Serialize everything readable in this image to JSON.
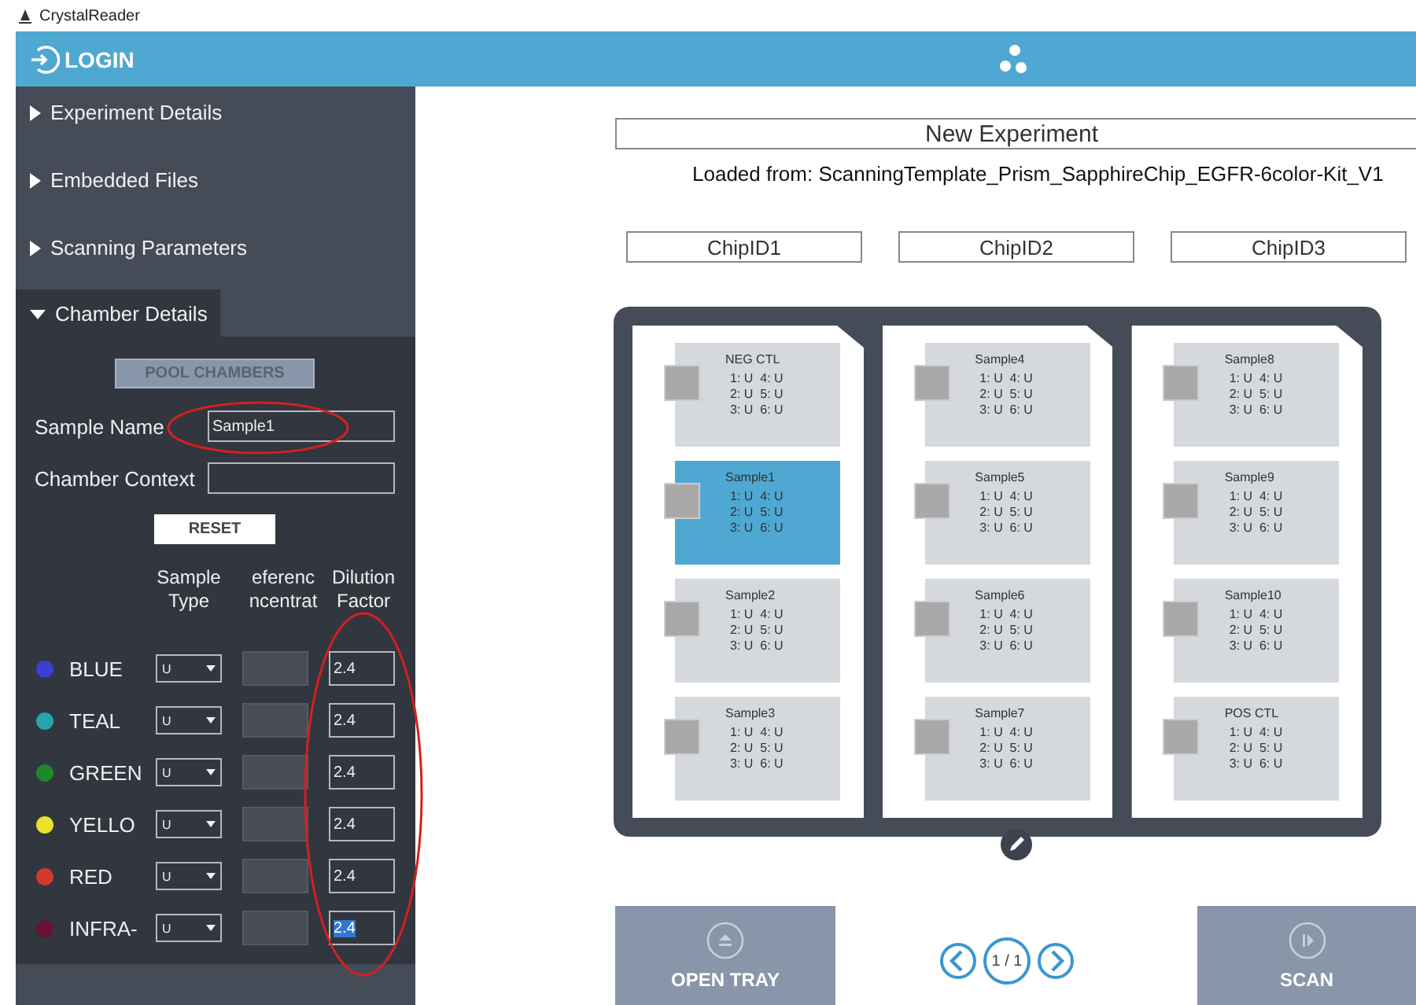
{
  "window": {
    "title": "CrystalReader"
  },
  "header": {
    "login_label": "LOGIN"
  },
  "sidebar": {
    "sections": [
      {
        "label": "Experiment Details",
        "expanded": false
      },
      {
        "label": "Embedded Files",
        "expanded": false
      },
      {
        "label": "Scanning Parameters",
        "expanded": false
      },
      {
        "label": "Chamber Details",
        "expanded": true
      }
    ],
    "chamber_details": {
      "pool_button": "POOL CHAMBERS",
      "fields": [
        {
          "label": "Sample Name",
          "value": "Sample1"
        },
        {
          "label": "Chamber Context"
        }
      ],
      "reset_button": "RESET",
      "column_headers": [
        [
          "Sample",
          "Type"
        ],
        [
          "eferenc",
          "ncentrat"
        ],
        [
          "Dilution",
          "Factor"
        ]
      ],
      "channels": [
        {
          "name": "BLUE",
          "color": "#3b3fd2",
          "sample_type": "U",
          "dilution": "2.4",
          "selected": false
        },
        {
          "name": "TEAL",
          "color": "#26a7a9",
          "sample_type": "U",
          "dilution": "2.4",
          "selected": false
        },
        {
          "name": "GREEN",
          "color": "#1c8a28",
          "sample_type": "U",
          "dilution": "2.4",
          "selected": false
        },
        {
          "name": "YELLO",
          "color": "#e9e12b",
          "sample_type": "U",
          "dilution": "2.4",
          "selected": false
        },
        {
          "name": "RED",
          "color": "#d3392b",
          "sample_type": "U",
          "dilution": "2.4",
          "selected": false
        },
        {
          "name": "INFRA-",
          "color": "#6a1131",
          "sample_type": "U",
          "dilution": "2.4",
          "selected": true
        }
      ]
    }
  },
  "main": {
    "experiment_name": "New Experiment",
    "loaded_from": "Loaded from: ScanningTemplate_Prism_SapphireChip_EGFR-6color-Kit_V1",
    "chips": [
      {
        "id": "ChipID1",
        "chambers": [
          {
            "name": "NEG CTL",
            "selected": false,
            "lines": [
              "1: U  4: U",
              "2: U  5: U",
              "3: U  6: U"
            ]
          },
          {
            "name": "Sample1",
            "selected": true,
            "lines": [
              "1: U  4: U",
              "2: U  5: U",
              "3: U  6: U"
            ]
          },
          {
            "name": "Sample2",
            "selected": false,
            "lines": [
              "1: U  4: U",
              "2: U  5: U",
              "3: U  6: U"
            ]
          },
          {
            "name": "Sample3",
            "selected": false,
            "lines": [
              "1: U  4: U",
              "2: U  5: U",
              "3: U  6: U"
            ]
          }
        ]
      },
      {
        "id": "ChipID2",
        "chambers": [
          {
            "name": "Sample4",
            "selected": false,
            "lines": [
              "1: U  4: U",
              "2: U  5: U",
              "3: U  6: U"
            ]
          },
          {
            "name": "Sample5",
            "selected": false,
            "lines": [
              "1: U  4: U",
              "2: U  5: U",
              "3: U  6: U"
            ]
          },
          {
            "name": "Sample6",
            "selected": false,
            "lines": [
              "1: U  4: U",
              "2: U  5: U",
              "3: U  6: U"
            ]
          },
          {
            "name": "Sample7",
            "selected": false,
            "lines": [
              "1: U  4: U",
              "2: U  5: U",
              "3: U  6: U"
            ]
          }
        ]
      },
      {
        "id": "ChipID3",
        "chambers": [
          {
            "name": "Sample8",
            "selected": false,
            "lines": [
              "1: U  4: U",
              "2: U  5: U",
              "3: U  6: U"
            ]
          },
          {
            "name": "Sample9",
            "selected": false,
            "lines": [
              "1: U  4: U",
              "2: U  5: U",
              "3: U  6: U"
            ]
          },
          {
            "name": "Sample10",
            "selected": false,
            "lines": [
              "1: U  4: U",
              "2: U  5: U",
              "3: U  6: U"
            ]
          },
          {
            "name": "POS CTL",
            "selected": false,
            "lines": [
              "1: U  4: U",
              "2: U  5: U",
              "3: U  6: U"
            ]
          }
        ]
      }
    ],
    "open_tray_button": "OPEN TRAY",
    "page_indicator": "1 / 1",
    "scan_button": "SCAN"
  }
}
